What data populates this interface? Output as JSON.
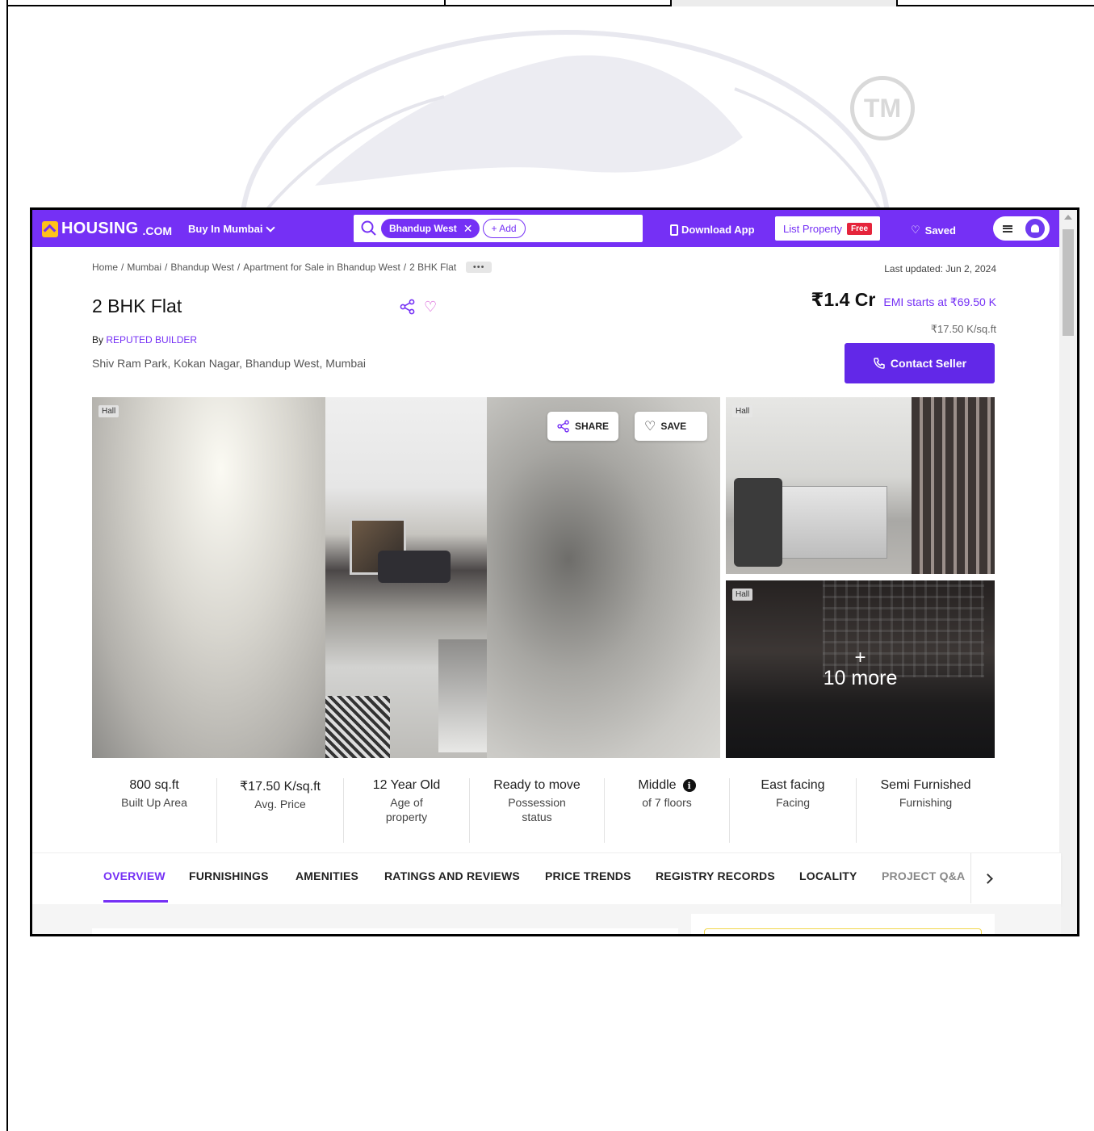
{
  "navbar": {
    "brand": "HOUSING",
    "brand_suffix": ".COM",
    "buy_dropdown": "Buy In Mumbai",
    "search_chip": "Bhandup West",
    "search_add": "+ Add",
    "download_app": "Download App",
    "list_property": "List Property",
    "free_badge": "Free",
    "saved": "Saved"
  },
  "breadcrumb": {
    "items": [
      "Home",
      "Mumbai",
      "Bhandup West",
      "Apartment for Sale in Bhandup West",
      "2 BHK Flat"
    ],
    "separator": "/",
    "more": "•••"
  },
  "listing": {
    "last_updated": "Last updated: Jun 2, 2024",
    "title": "2 BHK Flat",
    "by_prefix": "By",
    "builder": "REPUTED BUILDER",
    "address": "Shiv Ram Park, Kokan Nagar, Bhandup West, Mumbai",
    "price": "₹1.4 Cr",
    "emi": "EMI starts at ₹69.50 K",
    "price_per_sqft": "₹17.50 K/sq.ft",
    "contact_button": "Contact Seller"
  },
  "gallery": {
    "main_tag": "Hall",
    "share": "SHARE",
    "save": "SAVE",
    "thumb1_tag": "Hall",
    "thumb2_tag": "Hall",
    "more_plus": "+",
    "more_text": "10 more"
  },
  "facts": [
    {
      "value": "800 sq.ft",
      "label": "Built Up Area"
    },
    {
      "value": "₹17.50 K/sq.ft",
      "label": "Avg. Price"
    },
    {
      "value": "12 Year Old",
      "label": "Age of property"
    },
    {
      "value": "Ready to move",
      "label": "Possession status"
    },
    {
      "value": "Middle",
      "label": "of 7 floors"
    },
    {
      "value": "East facing",
      "label": "Facing"
    },
    {
      "value": "Semi Furnished",
      "label": "Furnishing"
    }
  ],
  "tabs": [
    "OVERVIEW",
    "FURNISHINGS",
    "AMENITIES",
    "RATINGS AND REVIEWS",
    "PRICE TRENDS",
    "REGISTRY RECORDS",
    "LOCALITY",
    "PROJECT Q&A"
  ],
  "icons": {
    "search": "search-icon",
    "share": "share-icon",
    "heart": "heart-icon",
    "phone": "phone-icon",
    "info": "info-icon",
    "next": "chevron-right-icon"
  },
  "colors": {
    "brand_purple": "#7530f5",
    "contact_button": "#6228e8",
    "brand_yellow": "#ffc21a",
    "free_badge": "#e5243b"
  }
}
